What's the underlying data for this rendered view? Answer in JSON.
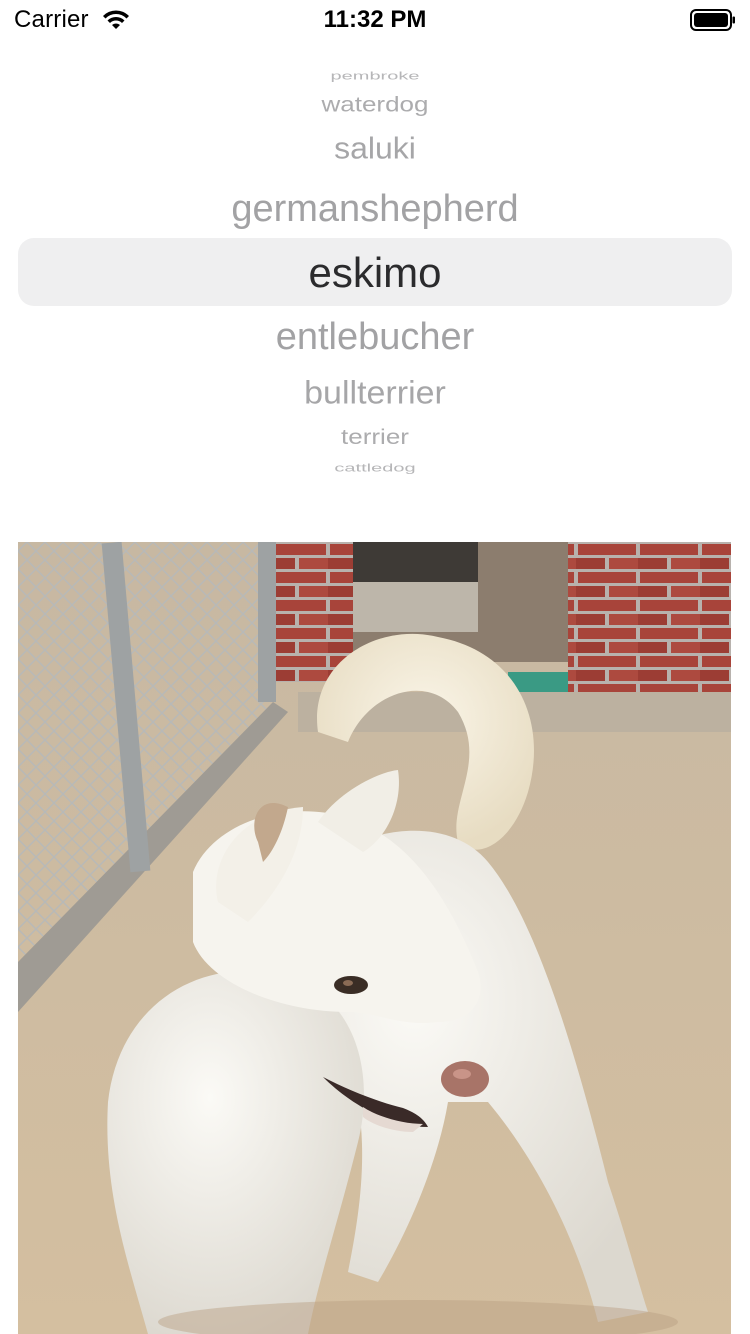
{
  "status_bar": {
    "carrier": "Carrier",
    "time": "11:32 PM",
    "wifi_icon": "wifi-icon",
    "battery_icon": "battery-full-icon"
  },
  "picker": {
    "rows": [
      "pembroke",
      "waterdog",
      "saluki",
      "germanshepherd",
      "eskimo",
      "entlebucher",
      "bullterrier",
      "terrier",
      "cattledog"
    ],
    "selected": "eskimo"
  },
  "photo": {
    "subject": "white eskimo dog"
  },
  "colors": {
    "highlight": "#efeff0",
    "selected_text": "#2b2b2d",
    "unselected_text": "#a2a2a4"
  }
}
